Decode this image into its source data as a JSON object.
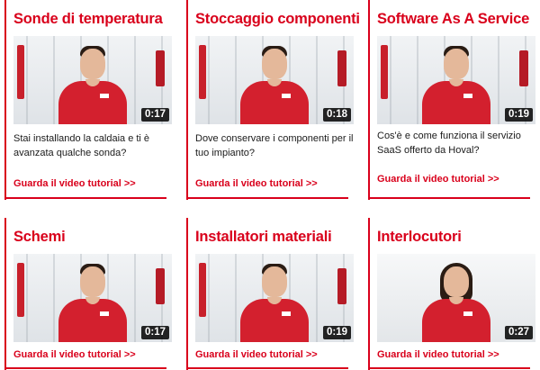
{
  "cards": [
    {
      "title": "Sonde di temperatura",
      "duration": "0:17",
      "description": "Stai installando la caldaia e ti è avanzata qualche sonda?",
      "cta": "Guarda il video tutorial >>",
      "presenter": "man"
    },
    {
      "title": "Stoccaggio componenti",
      "duration": "0:18",
      "description": "Dove conservare i componenti per il tuo impianto?",
      "cta": "Guarda il video tutorial >>",
      "presenter": "man"
    },
    {
      "title": "Software As A Service",
      "duration": "0:19",
      "description": "Cos'è e come funziona il servizio SaaS offerto da Hoval?",
      "cta": "Guarda il video tutorial >>",
      "presenter": "man"
    },
    {
      "title": "Schemi",
      "duration": "0:17",
      "description": "",
      "cta": "Guarda il video tutorial >>",
      "presenter": "man"
    },
    {
      "title": "Installatori materiali",
      "duration": "0:19",
      "description": "",
      "cta": "Guarda il video tutorial >>",
      "presenter": "man"
    },
    {
      "title": "Interlocutori",
      "duration": "0:27",
      "description": "",
      "cta": "Guarda il video tutorial >>",
      "presenter": "woman"
    }
  ],
  "colors": {
    "accent": "#d9001b",
    "text": "#1a1a1a",
    "badge_bg": "#000000"
  },
  "icons": {
    "thumbnail": "video-thumbnail",
    "duration": "duration-badge"
  }
}
